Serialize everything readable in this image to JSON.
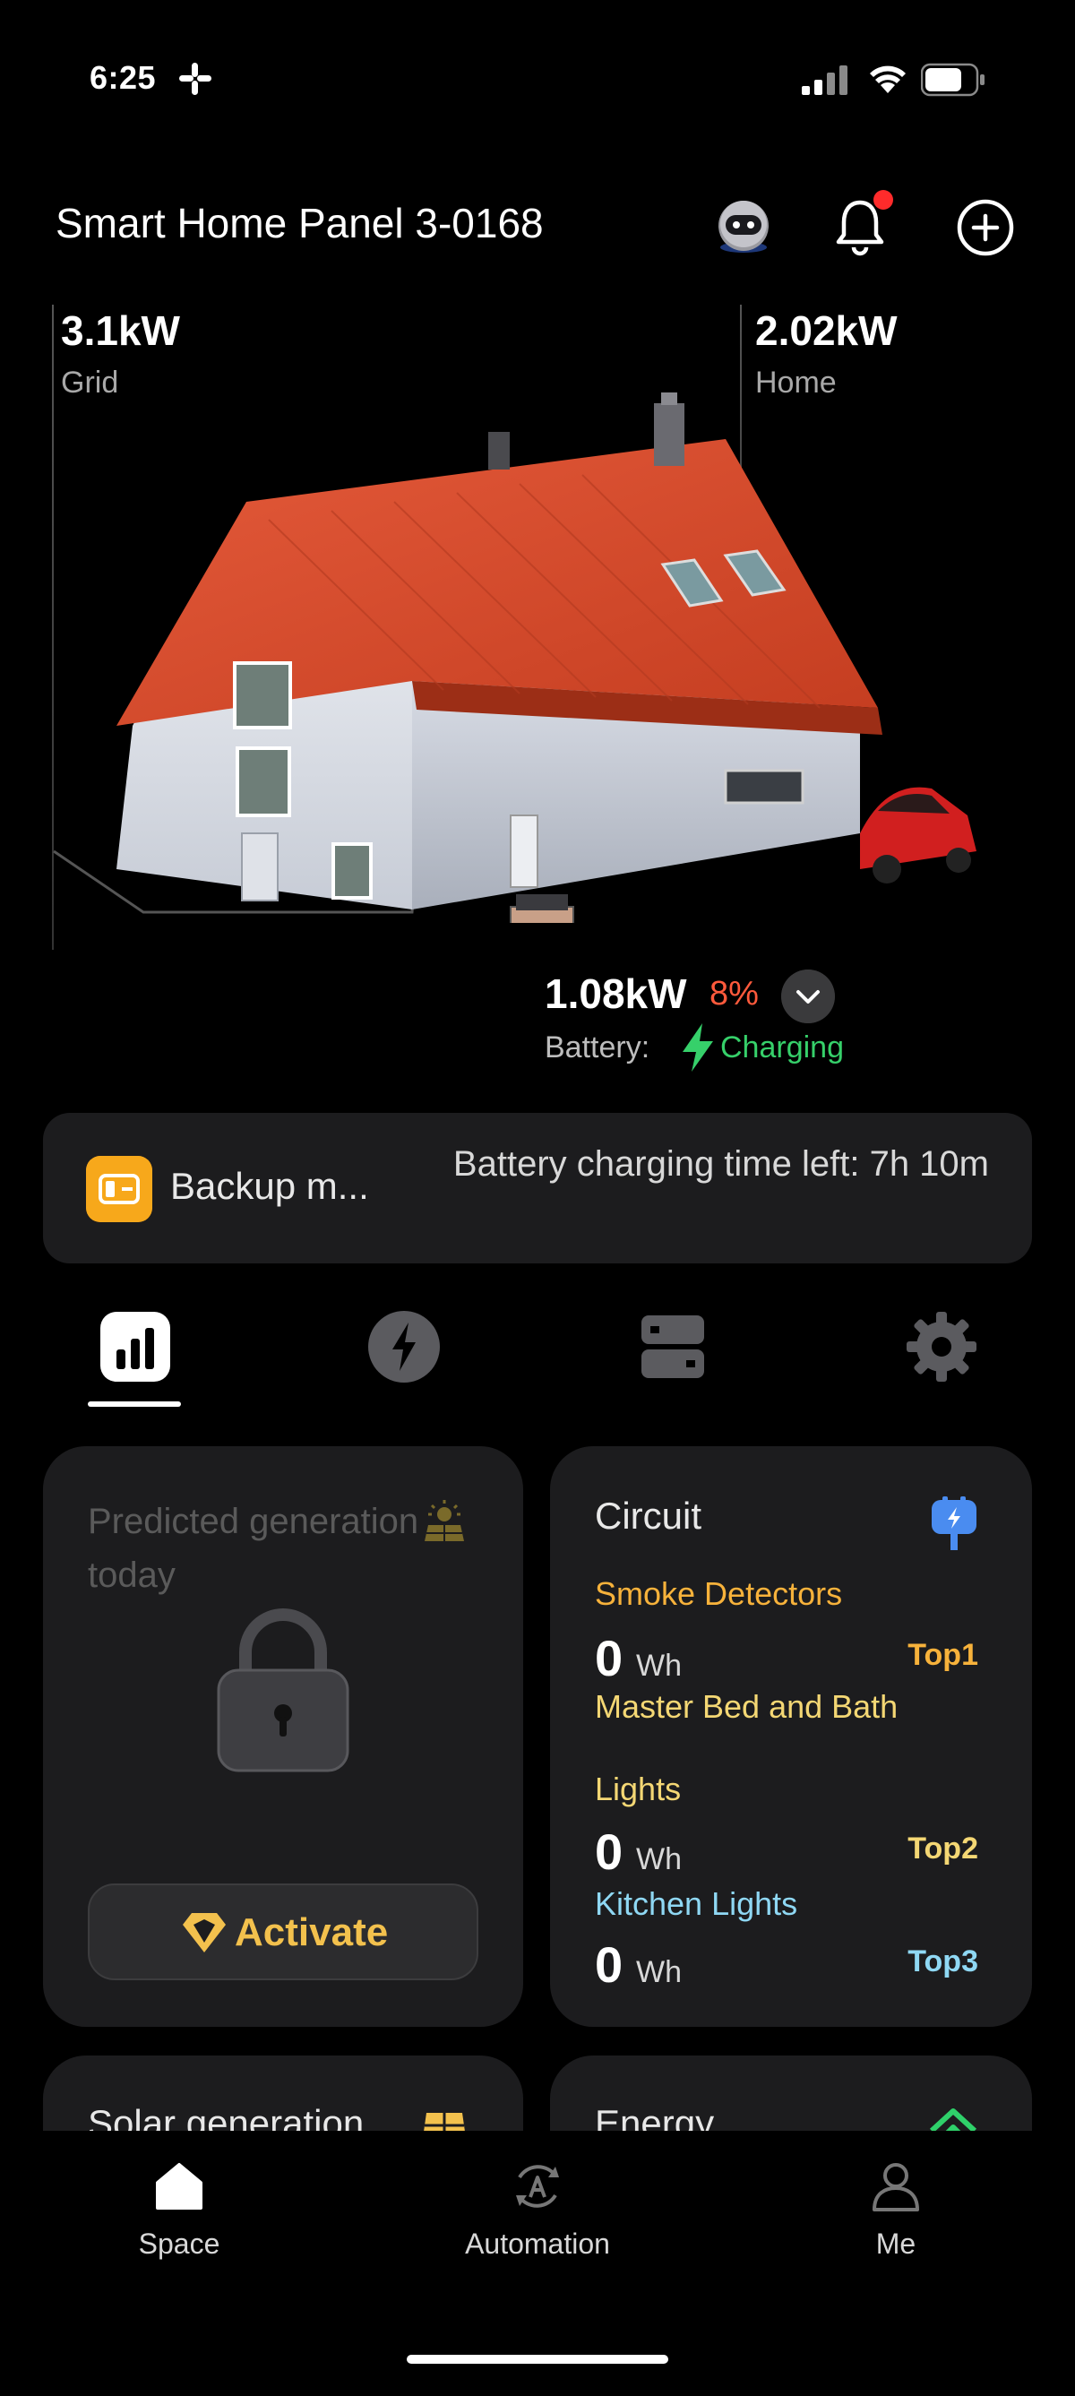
{
  "status_bar": {
    "time": "6:25"
  },
  "header": {
    "title": "Smart Home Panel 3-0168"
  },
  "hero": {
    "grid": {
      "value": "3.1kW",
      "label": "Grid"
    },
    "home": {
      "value": "2.02kW",
      "label": "Home"
    },
    "battery": {
      "value": "1.08kW",
      "percent": "8%",
      "label": "Battery:",
      "status": "Charging"
    }
  },
  "backup": {
    "name": "Backup m...",
    "time_left": "Battery charging time left: 7h 10m"
  },
  "tabs": [
    "stats",
    "power",
    "circuit",
    "settings"
  ],
  "predicted": {
    "title": "Predicted generation today",
    "activate_label": "Activate"
  },
  "circuit": {
    "title": "Circuit",
    "items": [
      {
        "name": "Smoke Detectors",
        "value": "0",
        "unit": "Wh",
        "rank": "Top1",
        "color": "#f7b23b"
      },
      {
        "name": "Master Bed and Bath",
        "value": "",
        "unit": "",
        "rank": "",
        "color": "#f4d774"
      },
      {
        "name": "Lights",
        "value": "0",
        "unit": "Wh",
        "rank": "Top2",
        "color": "#f4d774"
      },
      {
        "name": "Kitchen Lights",
        "value": "0",
        "unit": "Wh",
        "rank": "Top3",
        "color": "#8fd8f4"
      }
    ]
  },
  "peek_cards": {
    "solar_title": "Solar generation",
    "energy_title": "Energy"
  },
  "nav": {
    "space": "Space",
    "automation": "Automation",
    "me": "Me"
  }
}
